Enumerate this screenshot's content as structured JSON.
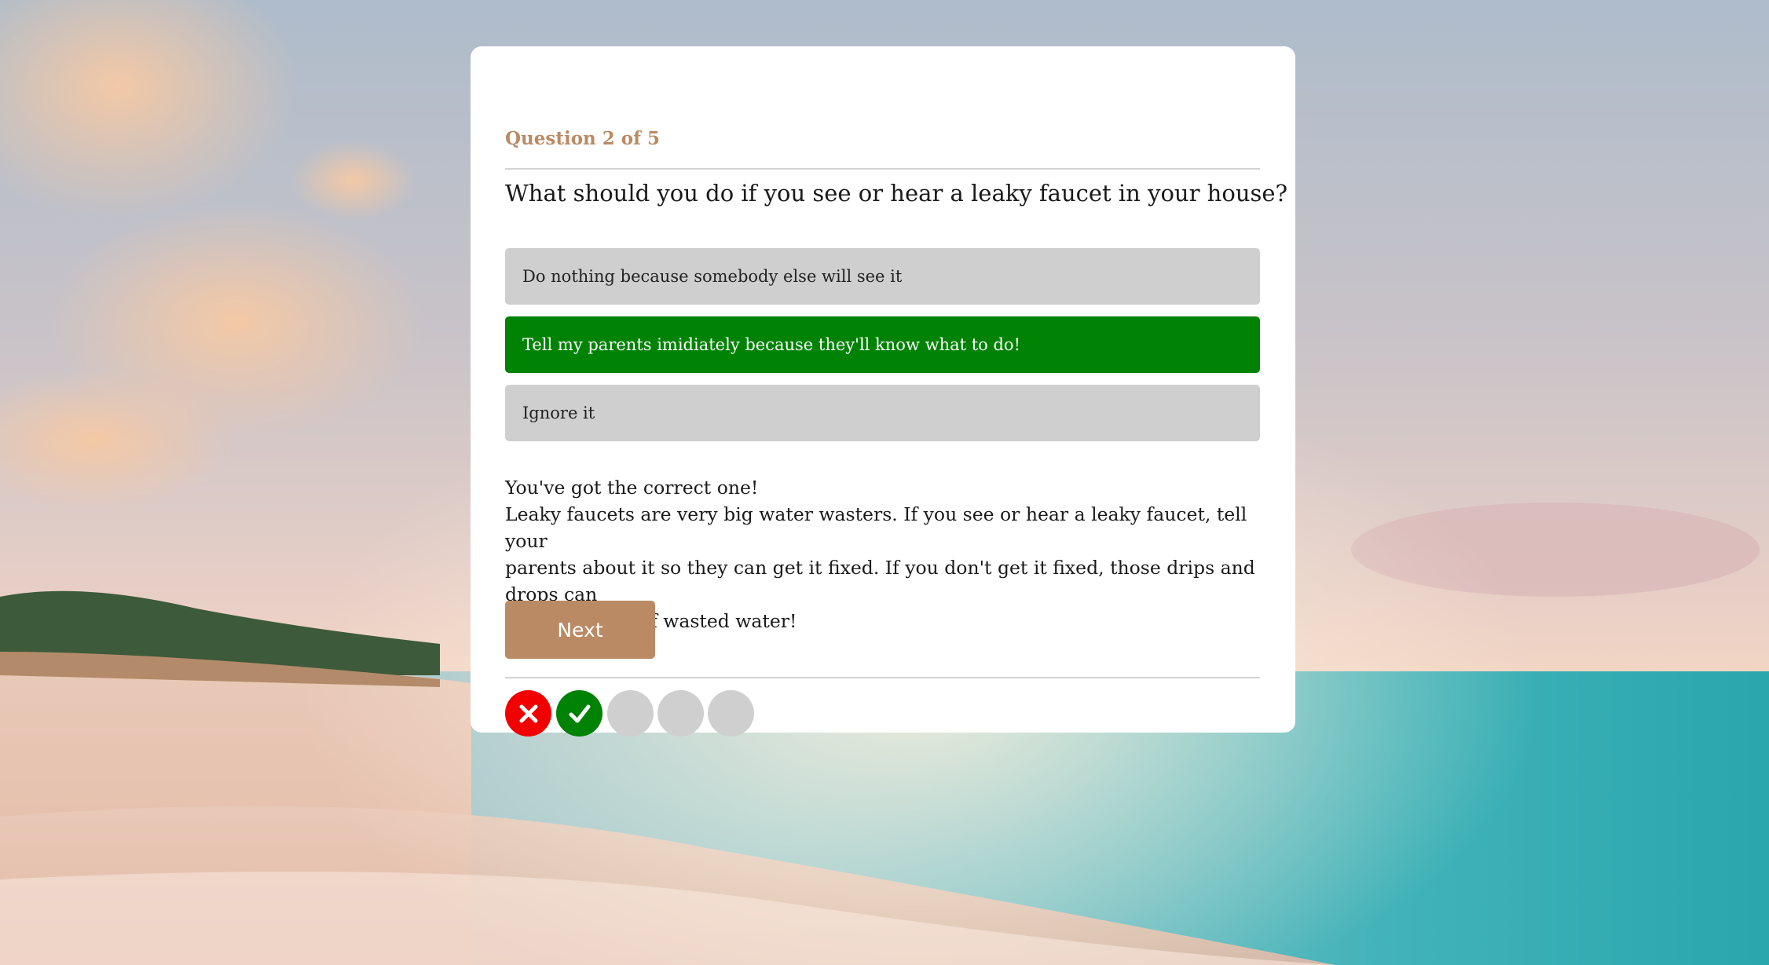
{
  "quiz": {
    "question_counter": "Question 2 of 5",
    "question_text": "What should you do if you see or hear a leaky faucet in your house?",
    "answers": [
      {
        "label": "Do nothing because somebody else will see it",
        "state": "unselected"
      },
      {
        "label": "Tell my parents imidiately because they'll know what to do!",
        "state": "correct"
      },
      {
        "label": "Ignore it",
        "state": "unselected"
      }
    ],
    "feedback": {
      "headline": "You've got the correct one!",
      "line1": "Leaky faucets are very big water wasters. If you see or hear a leaky faucet, tell your",
      "line2": "parents about it so they can get it fixed. If you don't get it fixed, those drips and drops can",
      "line3": "add up to lots of wasted water!"
    },
    "next_label": "Next",
    "progress": [
      {
        "state": "wrong",
        "icon": "x-icon"
      },
      {
        "state": "correct",
        "icon": "check-icon"
      },
      {
        "state": "pending"
      },
      {
        "state": "pending"
      },
      {
        "state": "pending"
      }
    ]
  },
  "colors": {
    "accent": "#b98a64",
    "correct": "#008204",
    "wrong": "#f20000",
    "neutral": "#cfcfcf"
  }
}
